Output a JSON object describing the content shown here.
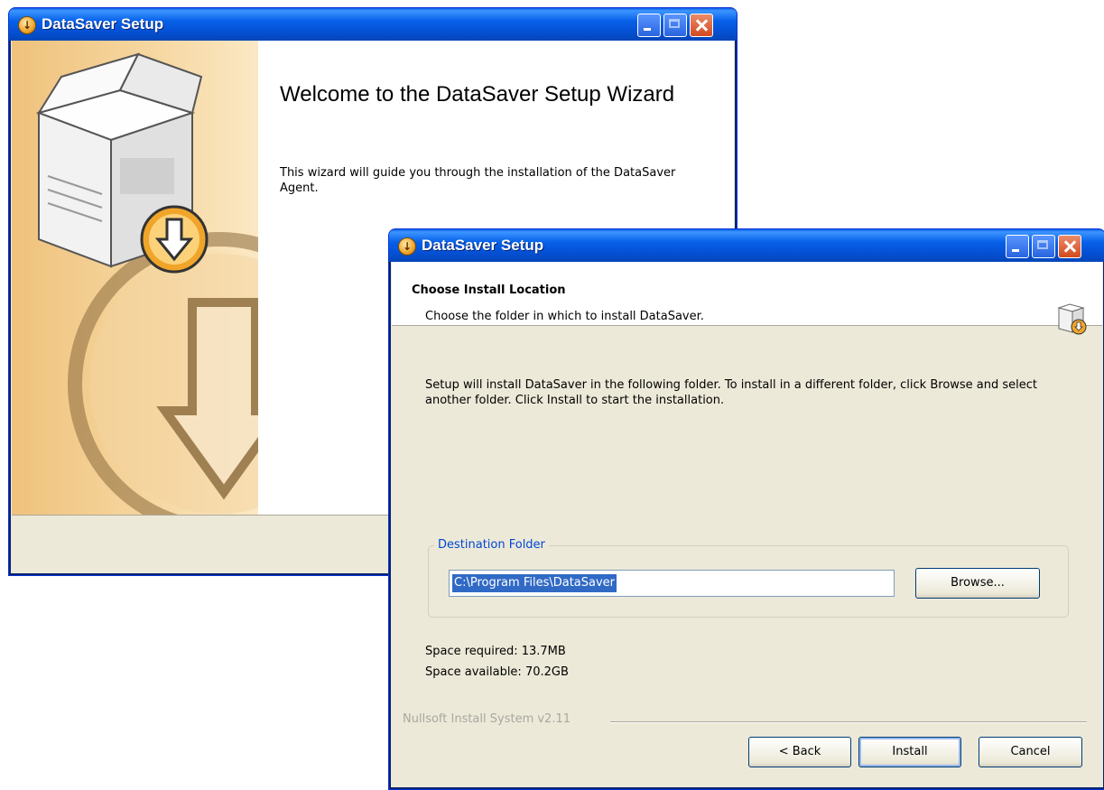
{
  "welcome_window": {
    "title": "DataSaver Setup",
    "heading": "Welcome to the DataSaver Setup Wizard",
    "body": "This wizard will guide you through the installation of the DataSaver Agent."
  },
  "install_window": {
    "title": "DataSaver Setup",
    "header_title": "Choose Install Location",
    "header_subtitle": "Choose the folder in which to install DataSaver.",
    "intro": "Setup will install DataSaver in the following folder. To install in a different folder, click Browse and select another folder. Click Install to start the installation.",
    "destination_label": "Destination Folder",
    "destination_path": "C:\\Program Files\\DataSaver",
    "browse_label": "Browse...",
    "space_required": "Space required: 13.7MB",
    "space_available": "Space available: 70.2GB",
    "branding": "Nullsoft Install System v2.11",
    "back_label": "< Back",
    "install_label": "Install",
    "cancel_label": "Cancel"
  },
  "colors": {
    "titlebar": "#0551d6",
    "close_button": "#d24a1e",
    "accent_orange": "#f0a52a",
    "group_label": "#0046d5",
    "selection": "#316ac5"
  },
  "icons": [
    "setup-app-icon",
    "minimize-icon",
    "maximize-icon",
    "close-icon",
    "installer-box-icon",
    "download-arrow-icon"
  ]
}
